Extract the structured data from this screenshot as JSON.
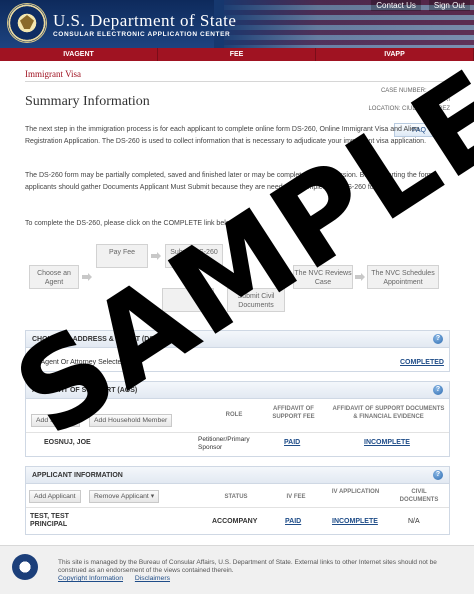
{
  "header": {
    "title": "U.S. Department of State",
    "subtitle": "CONSULAR ELECTRONIC APPLICATION CENTER",
    "links": [
      "Contact Us",
      "Sign Out"
    ]
  },
  "tabs": [
    "IVAGENT",
    "FEE",
    "IVAPP"
  ],
  "breadcrumb": "Immigrant Visa",
  "page_title": "Summary Information",
  "case_info": [
    "CASE NUMBER: ...75001",
    "INV: IRI",
    "LOCATION: CIUDAD JUAREZ"
  ],
  "faq_button": "FAQ",
  "paragraphs": [
    "The next step in the immigration process is for each applicant to complete online form DS-260, Online Immigrant Visa and Alien Registration Application. The DS-260 is used to collect information that is necessary to adjudicate your immigrant visa application.",
    "The DS-260 form may be partially completed, saved and finished later or may be completed in one session. Before starting the form, applicants should gather Documents Applicant Must Submit because they are needed to complete the DS-260 form.",
    "To complete the DS-260, please click on the COMPLETE link below."
  ],
  "flow": {
    "boxes": [
      "Choose an Agent",
      "Pay Fee",
      "Submit DS-260",
      "Submit Civil Documents",
      "The NVC Reviews Case",
      "The NVC Schedules Appointment"
    ]
  },
  "choice_panel": {
    "title": "CHOICE OF ADDRESS & AGENT (DS-261)",
    "row_label": "No Agent Or Attorney Selected",
    "status": "COMPLETED"
  },
  "aos_panel": {
    "title": "AFFIDAVIT OF SUPPORT (AOS)",
    "buttons": [
      "Add Sponsor",
      "Add Household Member"
    ],
    "headers": [
      "ROLE",
      "AFFIDAVIT OF SUPPORT FEE",
      "AFFIDAVIT OF SUPPORT DOCUMENTS & FINANCIAL EVIDENCE"
    ],
    "row": {
      "name": "EOSNUJ, JOE",
      "role": "Petitioner/Primary Sponsor",
      "fee": "PAID",
      "docs": "INCOMPLETE"
    }
  },
  "applicant_panel": {
    "title": "APPLICANT INFORMATION",
    "buttons": [
      "Add Applicant",
      "Remove Applicant"
    ],
    "headers": [
      "STATUS",
      "IV FEE",
      "IV APPLICATION",
      "CIVIL DOCUMENTS"
    ],
    "row": {
      "name": "TEST, TEST PRINCIPAL",
      "status": "ACCOMPANY",
      "fee": "PAID",
      "application": "INCOMPLETE",
      "civil_docs": "N/A"
    }
  },
  "footer": {
    "text": "This site is managed by the Bureau of Consular Affairs, U.S. Department of State. External links to other Internet sites should not be construed as an endorsement of the views contained therein.",
    "links": [
      "Copyright Information",
      "Disclaimers"
    ]
  },
  "watermark": "SAMPLE",
  "colors": {
    "brand_navy": "#16386f",
    "tab_red": "#a01322",
    "link_blue": "#1e4c88"
  }
}
